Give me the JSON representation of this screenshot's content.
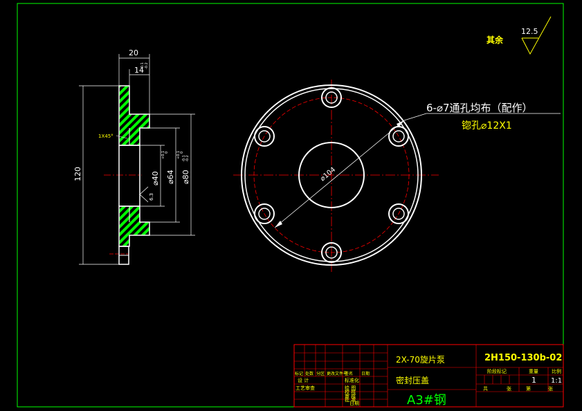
{
  "colors": {
    "background": "#000000",
    "border": "#00ff00",
    "part_outline": "#ffffff",
    "hatch": "#00ff00",
    "centerline": "#ff0000",
    "dimension": "#ffffff",
    "note": "#ffff00",
    "title_block": "#ff0000"
  },
  "surface_roughness": {
    "label": "其余",
    "value": "12.5"
  },
  "side_view": {
    "dims": {
      "total_width": "20",
      "flange_width": "14",
      "flange_tol_top": "-0.1",
      "flange_tol_bot": "-0.2",
      "overall_dia": "120",
      "bore_dia": "⌀40",
      "bore_tol_top": "+0.1",
      "bore_tol_bot": "0",
      "step_dia": "⌀64",
      "step_tol_top": "+0.1",
      "step_tol_bot": "0",
      "spigot_dia": "⌀80",
      "spigot_tol_top": "-0.1",
      "spigot_tol_bot": "-0.2",
      "chamfer": "1X45°",
      "roughness": "6.3"
    }
  },
  "front_view": {
    "pcd_label": "⌀104",
    "hole_note_line1": "6-⌀7通孔均布（配作）",
    "hole_note_line2": "锪孔⌀12X1"
  },
  "title_block": {
    "product_name": "2X-70旋片泵",
    "part_name": "密封压盖",
    "material": "A3#钢",
    "drawing_no": "2H150-130b-02",
    "quantity": "1",
    "scale": "1:1",
    "labels": {
      "revision_header": [
        "标记",
        "处数",
        "分区",
        "更改文件号",
        "签名",
        "日期"
      ],
      "design": "设 计",
      "standardization": "标准化",
      "process": "工艺审查",
      "drawing": "绘 图",
      "check": "校 核",
      "review": "审 核",
      "approve": "批 准",
      "date": "日期",
      "stage": "阶段标记",
      "weight": "重量",
      "scale_label": "比例",
      "sheets_total": "共",
      "sheets": "张",
      "sheet_no": "第",
      "sheet_unit": "张"
    }
  }
}
